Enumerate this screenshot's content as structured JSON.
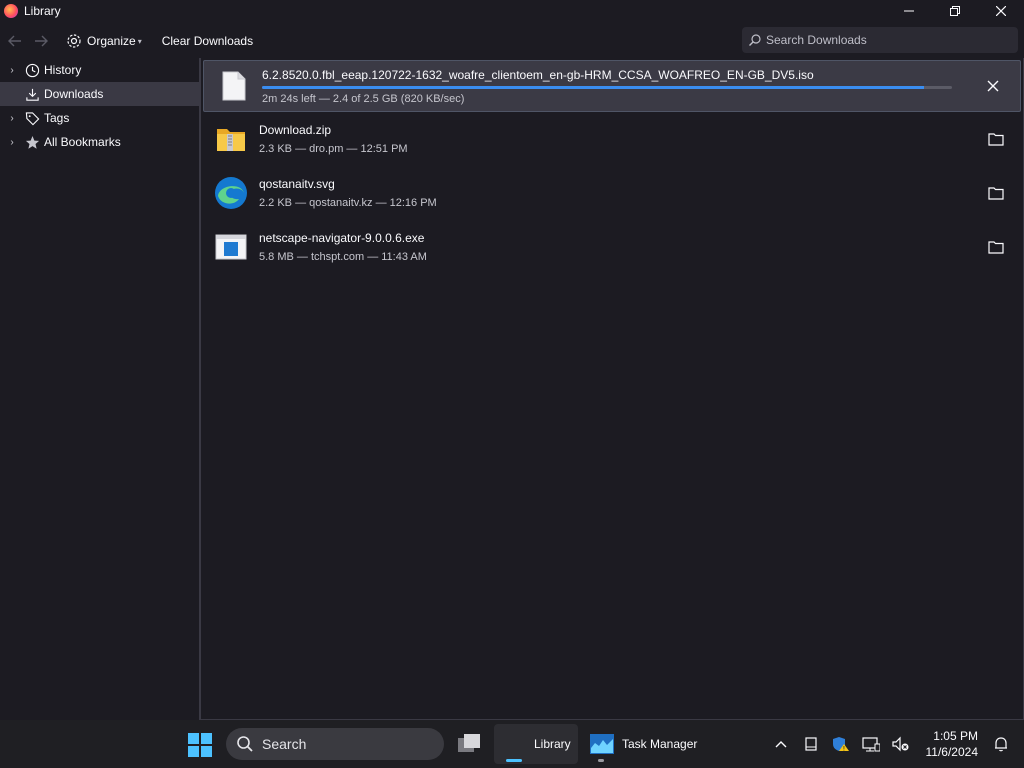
{
  "window": {
    "title": "Library"
  },
  "toolbar": {
    "organize_label": "Organize",
    "clear_label": "Clear Downloads",
    "search_placeholder": "Search Downloads"
  },
  "sidebar": {
    "items": [
      {
        "label": "History",
        "icon": "clock-icon"
      },
      {
        "label": "Downloads",
        "icon": "download-icon"
      },
      {
        "label": "Tags",
        "icon": "tag-icon"
      },
      {
        "label": "All Bookmarks",
        "icon": "star-icon"
      }
    ]
  },
  "downloads": [
    {
      "name": "6.2.8520.0.fbl_eeap.120722-1632_woafre_clientoem_en-gb-HRM_CCSA_WOAFREO_EN-GB_DV5.iso",
      "status": "2m 24s left — 2.4 of 2.5 GB (820 KB/sec)",
      "progress": 0.96,
      "icon": "file-icon"
    },
    {
      "name": "Download.zip",
      "status": "2.3 KB — dro.pm — 12:51 PM",
      "icon": "zip-folder-icon"
    },
    {
      "name": "qostanaitv.svg",
      "status": "2.2 KB — qostanaitv.kz — 12:16 PM",
      "icon": "edge-icon"
    },
    {
      "name": "netscape-navigator-9.0.0.6.exe",
      "status": "5.8 MB — tchspt.com — 11:43 AM",
      "icon": "exe-icon"
    }
  ],
  "taskbar": {
    "search_label": "Search",
    "apps": [
      {
        "label": "Library"
      },
      {
        "label": "Task Manager"
      }
    ],
    "time": "1:05 PM",
    "date": "11/6/2024"
  },
  "colors": {
    "accent": "#3a8df0",
    "background": "#1c1b22",
    "selected": "#3a3944"
  }
}
